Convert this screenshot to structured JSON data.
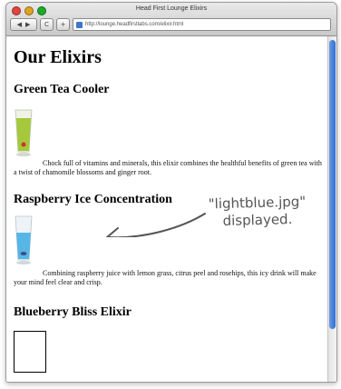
{
  "window": {
    "title": "Head First Lounge Elixirs",
    "url": "http://lounge.headfirstlabs.com/elixir.html",
    "nav_back": "◀",
    "nav_forward": "▶",
    "reload": "C",
    "add": "+"
  },
  "page": {
    "heading": "Our Elixirs",
    "elixirs": [
      {
        "name": "Green Tea Cooler",
        "description": "Chock full of vitamins and minerals, this elixir combines the healthful benefits of green tea with a twist of chamomile blossoms and ginger root.",
        "image": "green-glass"
      },
      {
        "name": "Raspberry Ice Concentration",
        "description": "Combining raspberry juice with lemon grass, citrus peel and rosehips, this icy drink will make your mind feel clear and crisp.",
        "image": "lightblue-glass"
      },
      {
        "name": "Blueberry Bliss Elixir",
        "description": "",
        "image": "missing"
      }
    ]
  },
  "annotation": {
    "line1": "\"lightblue.jpg\"",
    "line2": "displayed."
  },
  "colors": {
    "accent_scroll": "#2f6fd6",
    "green_drink": "#a6c83c",
    "blue_drink": "#58b6e6",
    "annotation": "#555555"
  }
}
